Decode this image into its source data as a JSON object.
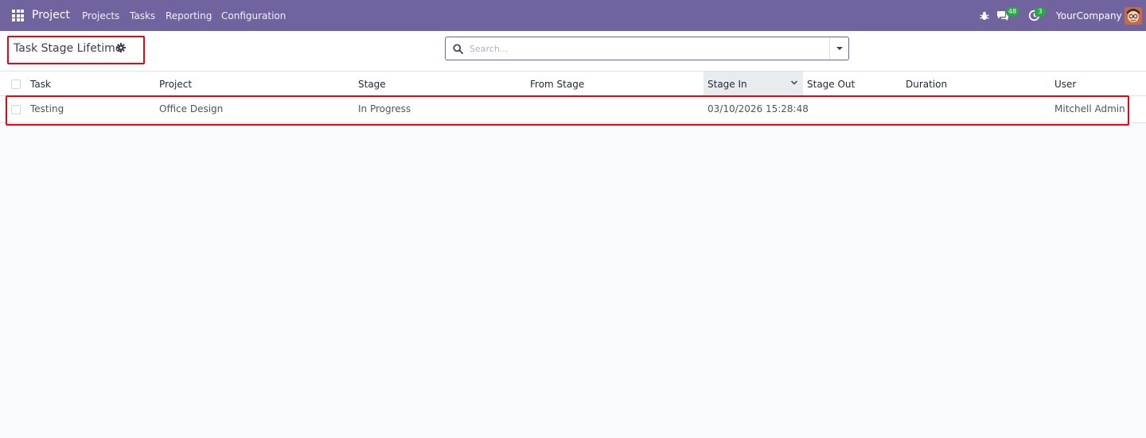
{
  "navbar": {
    "app_name": "Project",
    "menu": [
      "Projects",
      "Tasks",
      "Reporting",
      "Configuration"
    ],
    "messages_count": "48",
    "activities_count": "3",
    "company": "YourCompany",
    "color": "#71639e"
  },
  "control_panel": {
    "title": "Task Stage Lifetime",
    "search_placeholder": "Search..."
  },
  "table": {
    "columns": [
      "Task",
      "Project",
      "Stage",
      "From Stage",
      "Stage In",
      "Stage Out",
      "Duration",
      "User"
    ],
    "sorted_column": "Stage In",
    "rows": [
      {
        "task": "Testing",
        "project": "Office Design",
        "stage": "In Progress",
        "from_stage": "",
        "stage_in": "03/10/2026 15:28:48",
        "stage_out": "",
        "duration": "",
        "user": "Mitchell Admin"
      }
    ]
  },
  "highlight_color": "#e30613"
}
